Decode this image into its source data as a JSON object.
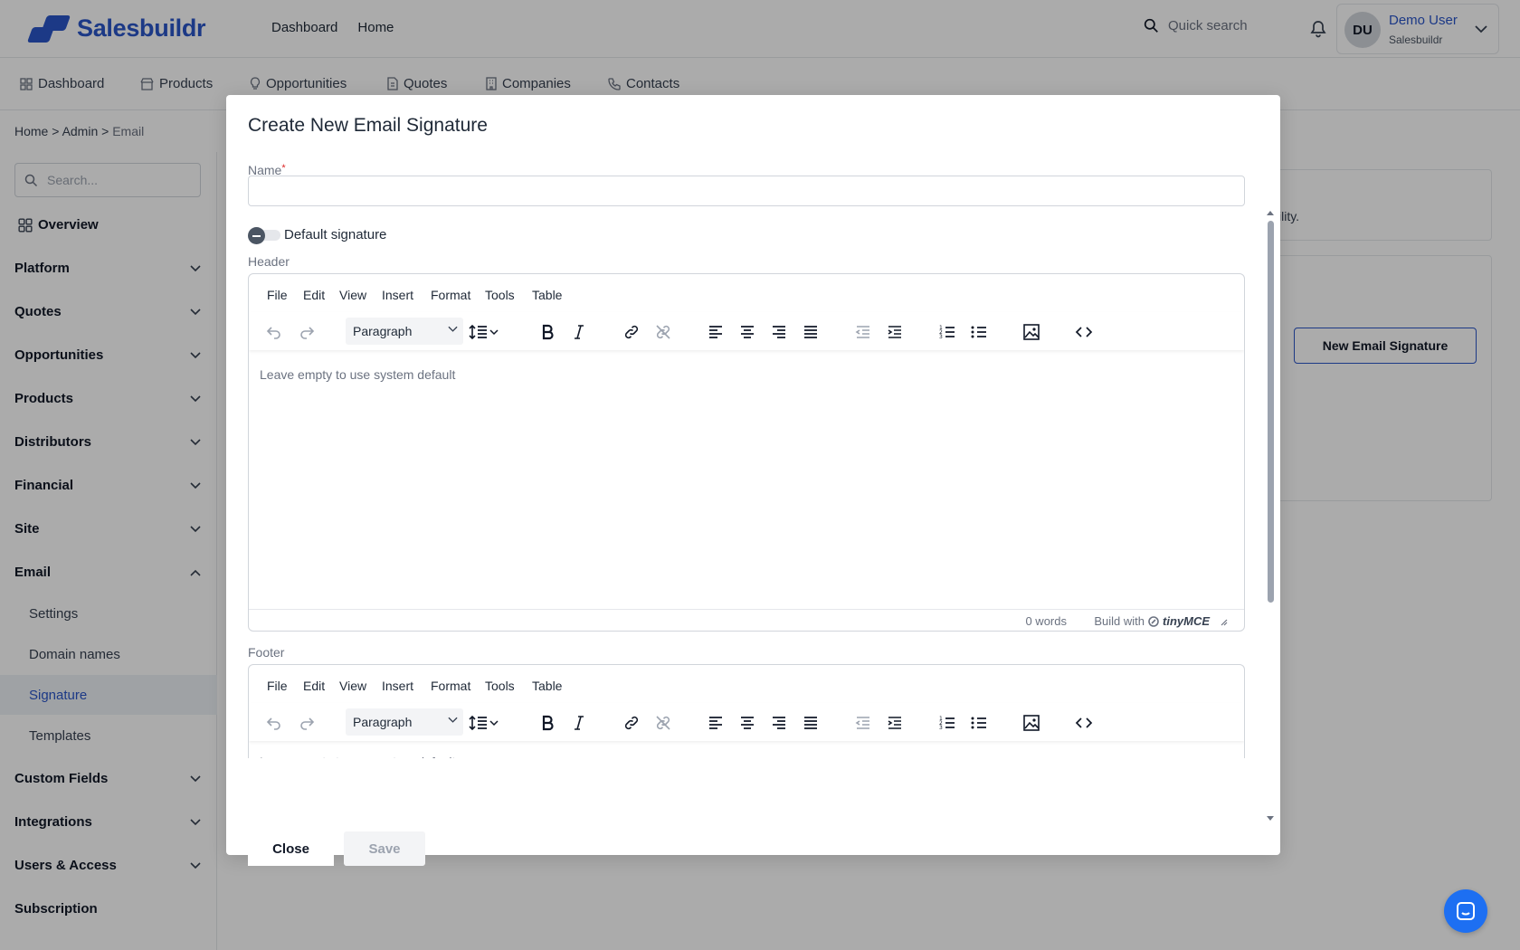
{
  "app": {
    "brand": "Salesbuildr",
    "brand_color": "#2a55c8"
  },
  "topbar": {
    "links": [
      "Dashboard",
      "Home"
    ],
    "search_placeholder": "Quick search",
    "user": {
      "initials": "DU",
      "name": "Demo User",
      "org": "Salesbuildr"
    }
  },
  "navbar": {
    "items": [
      {
        "label": "Dashboard",
        "icon": "grid-icon"
      },
      {
        "label": "Products",
        "icon": "store-icon"
      },
      {
        "label": "Opportunities",
        "icon": "lightbulb-icon"
      },
      {
        "label": "Quotes",
        "icon": "document-icon"
      },
      {
        "label": "Companies",
        "icon": "building-icon"
      },
      {
        "label": "Contacts",
        "icon": "phone-icon"
      }
    ]
  },
  "breadcrumb": {
    "home": "Home",
    "admin": "Admin",
    "current": "Email",
    "sep": ">"
  },
  "sidebar": {
    "search_placeholder": "Search...",
    "overview": "Overview",
    "sections": [
      "Platform",
      "Quotes",
      "Opportunities",
      "Products",
      "Distributors",
      "Financial",
      "Site",
      "Email"
    ],
    "email_sub": [
      "Settings",
      "Domain names",
      "Signature",
      "Templates"
    ],
    "sections_after": [
      "Custom Fields",
      "Integrations",
      "Users & Access",
      "Subscription"
    ],
    "active_sub": "Signature"
  },
  "main": {
    "card_text": "ility.",
    "new_signature_button": "New Email Signature"
  },
  "modal": {
    "title": "Create New Email Signature",
    "name_label": "Name",
    "required_mark": "*",
    "name_value": "",
    "default_toggle_label": "Default signature",
    "default_toggle_on": false,
    "header_label": "Header",
    "footer_label": "Footer",
    "editor": {
      "menus": [
        "File",
        "Edit",
        "View",
        "Insert",
        "Format",
        "Tools",
        "Table"
      ],
      "block_format": "Paragraph",
      "placeholder": "Leave empty to use system default",
      "word_count": "0 words",
      "build_with": "Build with",
      "brand": "tinyMCE"
    },
    "close_button": "Close",
    "save_button": "Save"
  }
}
